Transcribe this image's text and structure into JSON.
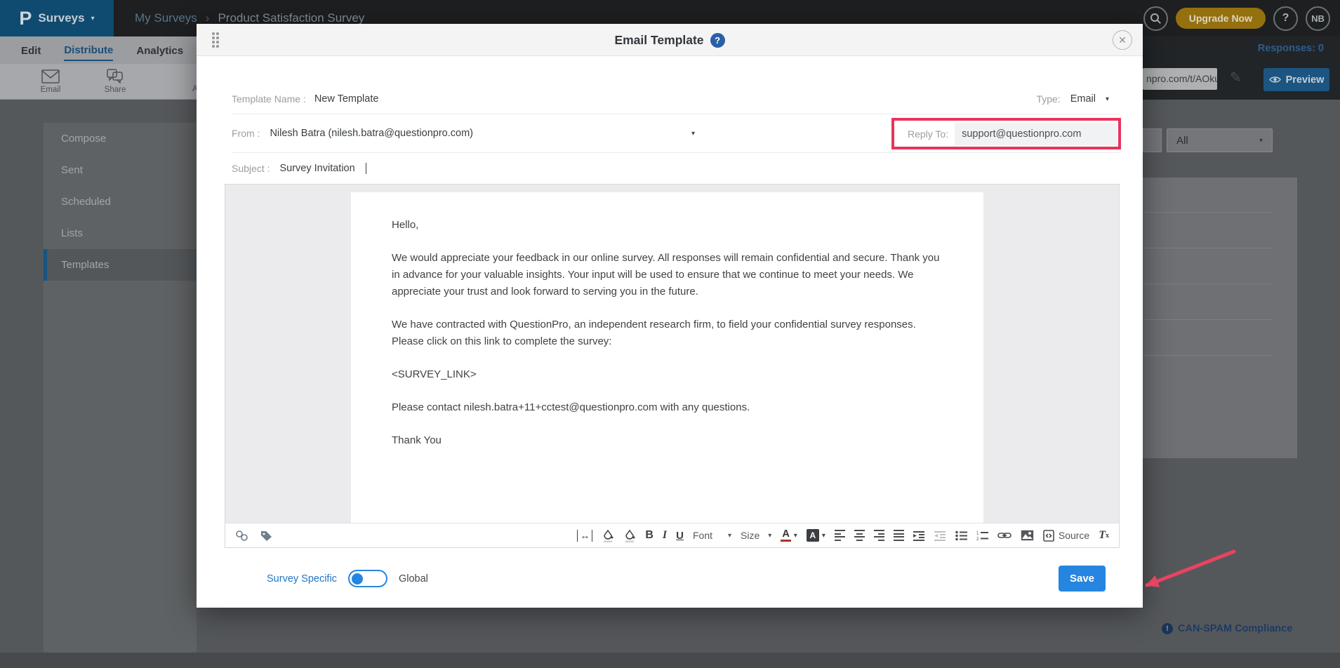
{
  "glyphs": {
    "caret_down": "▾",
    "chevron_right": "›",
    "close": "✕",
    "pencil": "✎",
    "help": "?",
    "bang": "!"
  },
  "header": {
    "logo_letter": "P",
    "product": "Surveys",
    "breadcrumb_parent": "My Surveys",
    "breadcrumb_current": "Product Satisfaction Survey",
    "upgrade_label": "Upgrade Now",
    "avatar_initials": "NB"
  },
  "tabs": {
    "items": [
      {
        "label": "Edit"
      },
      {
        "label": "Distribute"
      },
      {
        "label": "Analytics"
      }
    ],
    "active": "Distribute",
    "responses_label": "Responses: 0"
  },
  "distribute_toolbar": {
    "email_label": "Email",
    "share_label": "Share",
    "partial_label": "A",
    "url_fragment": "npro.com/t/AOku",
    "preview_label": "Preview"
  },
  "sidebar": {
    "items": [
      {
        "label": "Compose"
      },
      {
        "label": "Sent"
      },
      {
        "label": "Scheduled"
      },
      {
        "label": "Lists"
      },
      {
        "label": "Templates"
      }
    ],
    "active": "Templates"
  },
  "background_panel": {
    "filter_value": "All"
  },
  "footer_note": {
    "can_spam": "CAN-SPAM Compliance"
  },
  "modal": {
    "title": "Email Template",
    "fields": {
      "template_name_label": "Template Name :",
      "template_name_value": "New Template",
      "type_label": "Type:",
      "type_value": "Email",
      "from_label": "From :",
      "from_value": "Nilesh Batra (nilesh.batra@questionpro.com)",
      "reply_to_label": "Reply To:",
      "reply_to_value": "support@questionpro.com",
      "subject_label": "Subject :",
      "subject_value": "Survey Invitation"
    },
    "body_paragraphs": [
      "Hello,",
      "We would appreciate your feedback in our online survey. All responses will remain confidential and secure. Thank you in advance for your valuable insights. Your input will be used to ensure that we continue to meet your needs. We appreciate your trust and look forward to serving you in the future.",
      "We have contracted with QuestionPro, an independent research firm, to field your confidential survey responses. Please click on this link to complete the survey:",
      "<SURVEY_LINK>",
      "Please contact nilesh.batra+11+cctest@questionpro.com with any questions.",
      "Thank You"
    ],
    "editor": {
      "font_label": "Font",
      "size_label": "Size",
      "source_label": "Source"
    },
    "footer": {
      "survey_specific_label": "Survey Specific",
      "global_label": "Global",
      "save_label": "Save"
    }
  },
  "colors": {
    "brand_blue": "#1b87c9",
    "highlight_red": "#e8345c",
    "save_blue": "#2685e0",
    "upgrade_gold": "#c7941c",
    "modal_header_bg": "#f4f4f4"
  }
}
